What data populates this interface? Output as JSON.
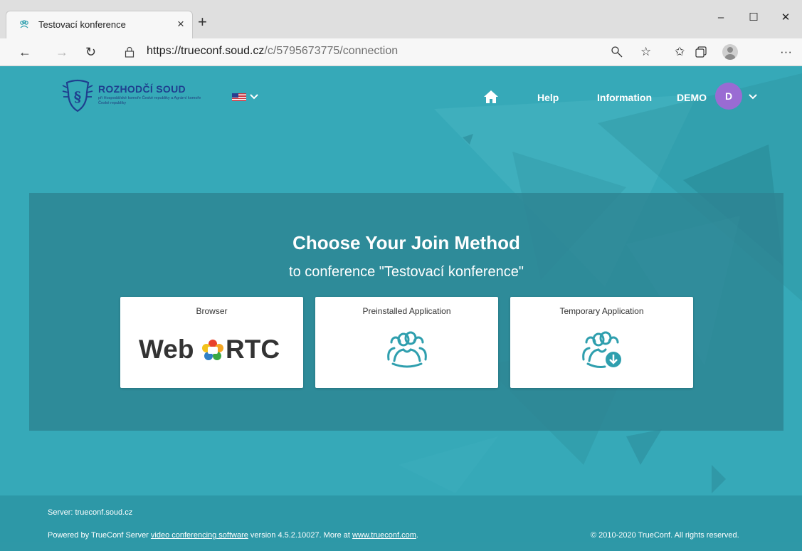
{
  "browser": {
    "tab_title": "Testovací konference",
    "tab_close": "×",
    "new_tab": "+",
    "url_host": "https://trueconf.soud.cz",
    "url_path": "/c/5795673775/connection",
    "window_controls": {
      "minimize": "–",
      "maximize": "☐",
      "close": "✕"
    },
    "nav": {
      "back": "←",
      "forward": "→",
      "refresh": "↻"
    },
    "toolbar_icons": [
      "search-icon",
      "favorite-star-icon",
      "favorites-list-icon",
      "collections-icon",
      "profile-icon",
      "more-icon"
    ],
    "more": "···"
  },
  "header": {
    "logo_title": "ROZHODČÍ SOUD",
    "logo_subtitle": "při Hospodářské komoře České republiky a Agrární komoře České republiky",
    "nav_help": "Help",
    "nav_information": "Information",
    "user_name": "DEMO",
    "avatar_letter": "D"
  },
  "main": {
    "headline": "Choose Your Join Method",
    "subline": "to conference \"Testovací konference\"",
    "cards": [
      {
        "label": "Browser",
        "logo_left": "Web",
        "logo_right": "RTC"
      },
      {
        "label": "Preinstalled Application"
      },
      {
        "label": "Temporary Application"
      }
    ]
  },
  "footer": {
    "server": "Server: trueconf.soud.cz",
    "powered_prefix": "Powered by TrueConf Server ",
    "powered_link": "video conferencing software",
    "powered_mid": " version 4.5.2.10027. More at ",
    "powered_site": "www.trueconf.com",
    "powered_end": ".",
    "copyright": "© 2010-2020 TrueConf. All rights reserved."
  },
  "colors": {
    "page_bg": "#36a9b8",
    "panel_bg": "#2d8492",
    "icon_teal": "#2f9fae",
    "avatar": "#9a6bd3",
    "logo_blue": "#1f3f8f"
  }
}
